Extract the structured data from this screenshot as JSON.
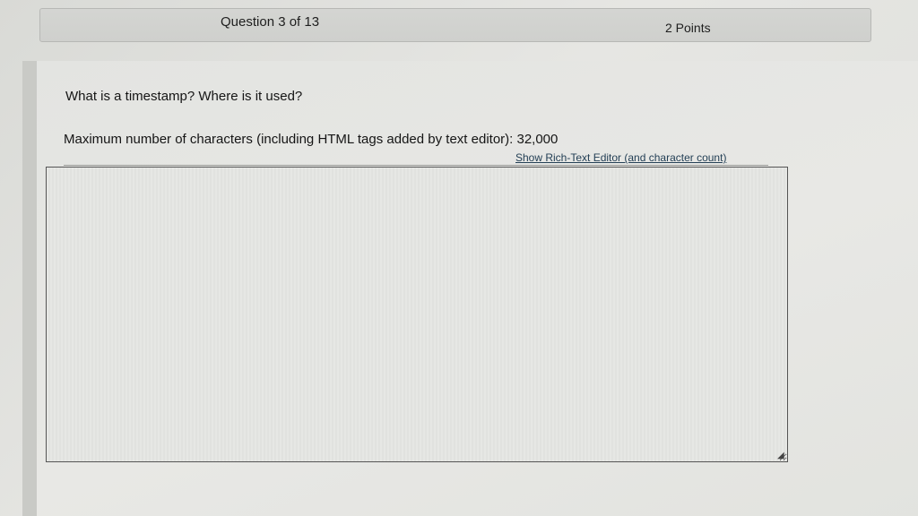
{
  "header": {
    "question_label": "Question 3 of 13",
    "points_label": "2 Points"
  },
  "question": {
    "text": "What is a timestamp? Where is it used?",
    "max_chars_label": "Maximum number of characters (including HTML tags added by text editor): 32,000",
    "rich_text_link": "Show Rich-Text Editor (and character count)"
  },
  "answer": {
    "value": "",
    "placeholder": ""
  },
  "icons": {
    "resize_grip": "resize-grip-icon"
  }
}
